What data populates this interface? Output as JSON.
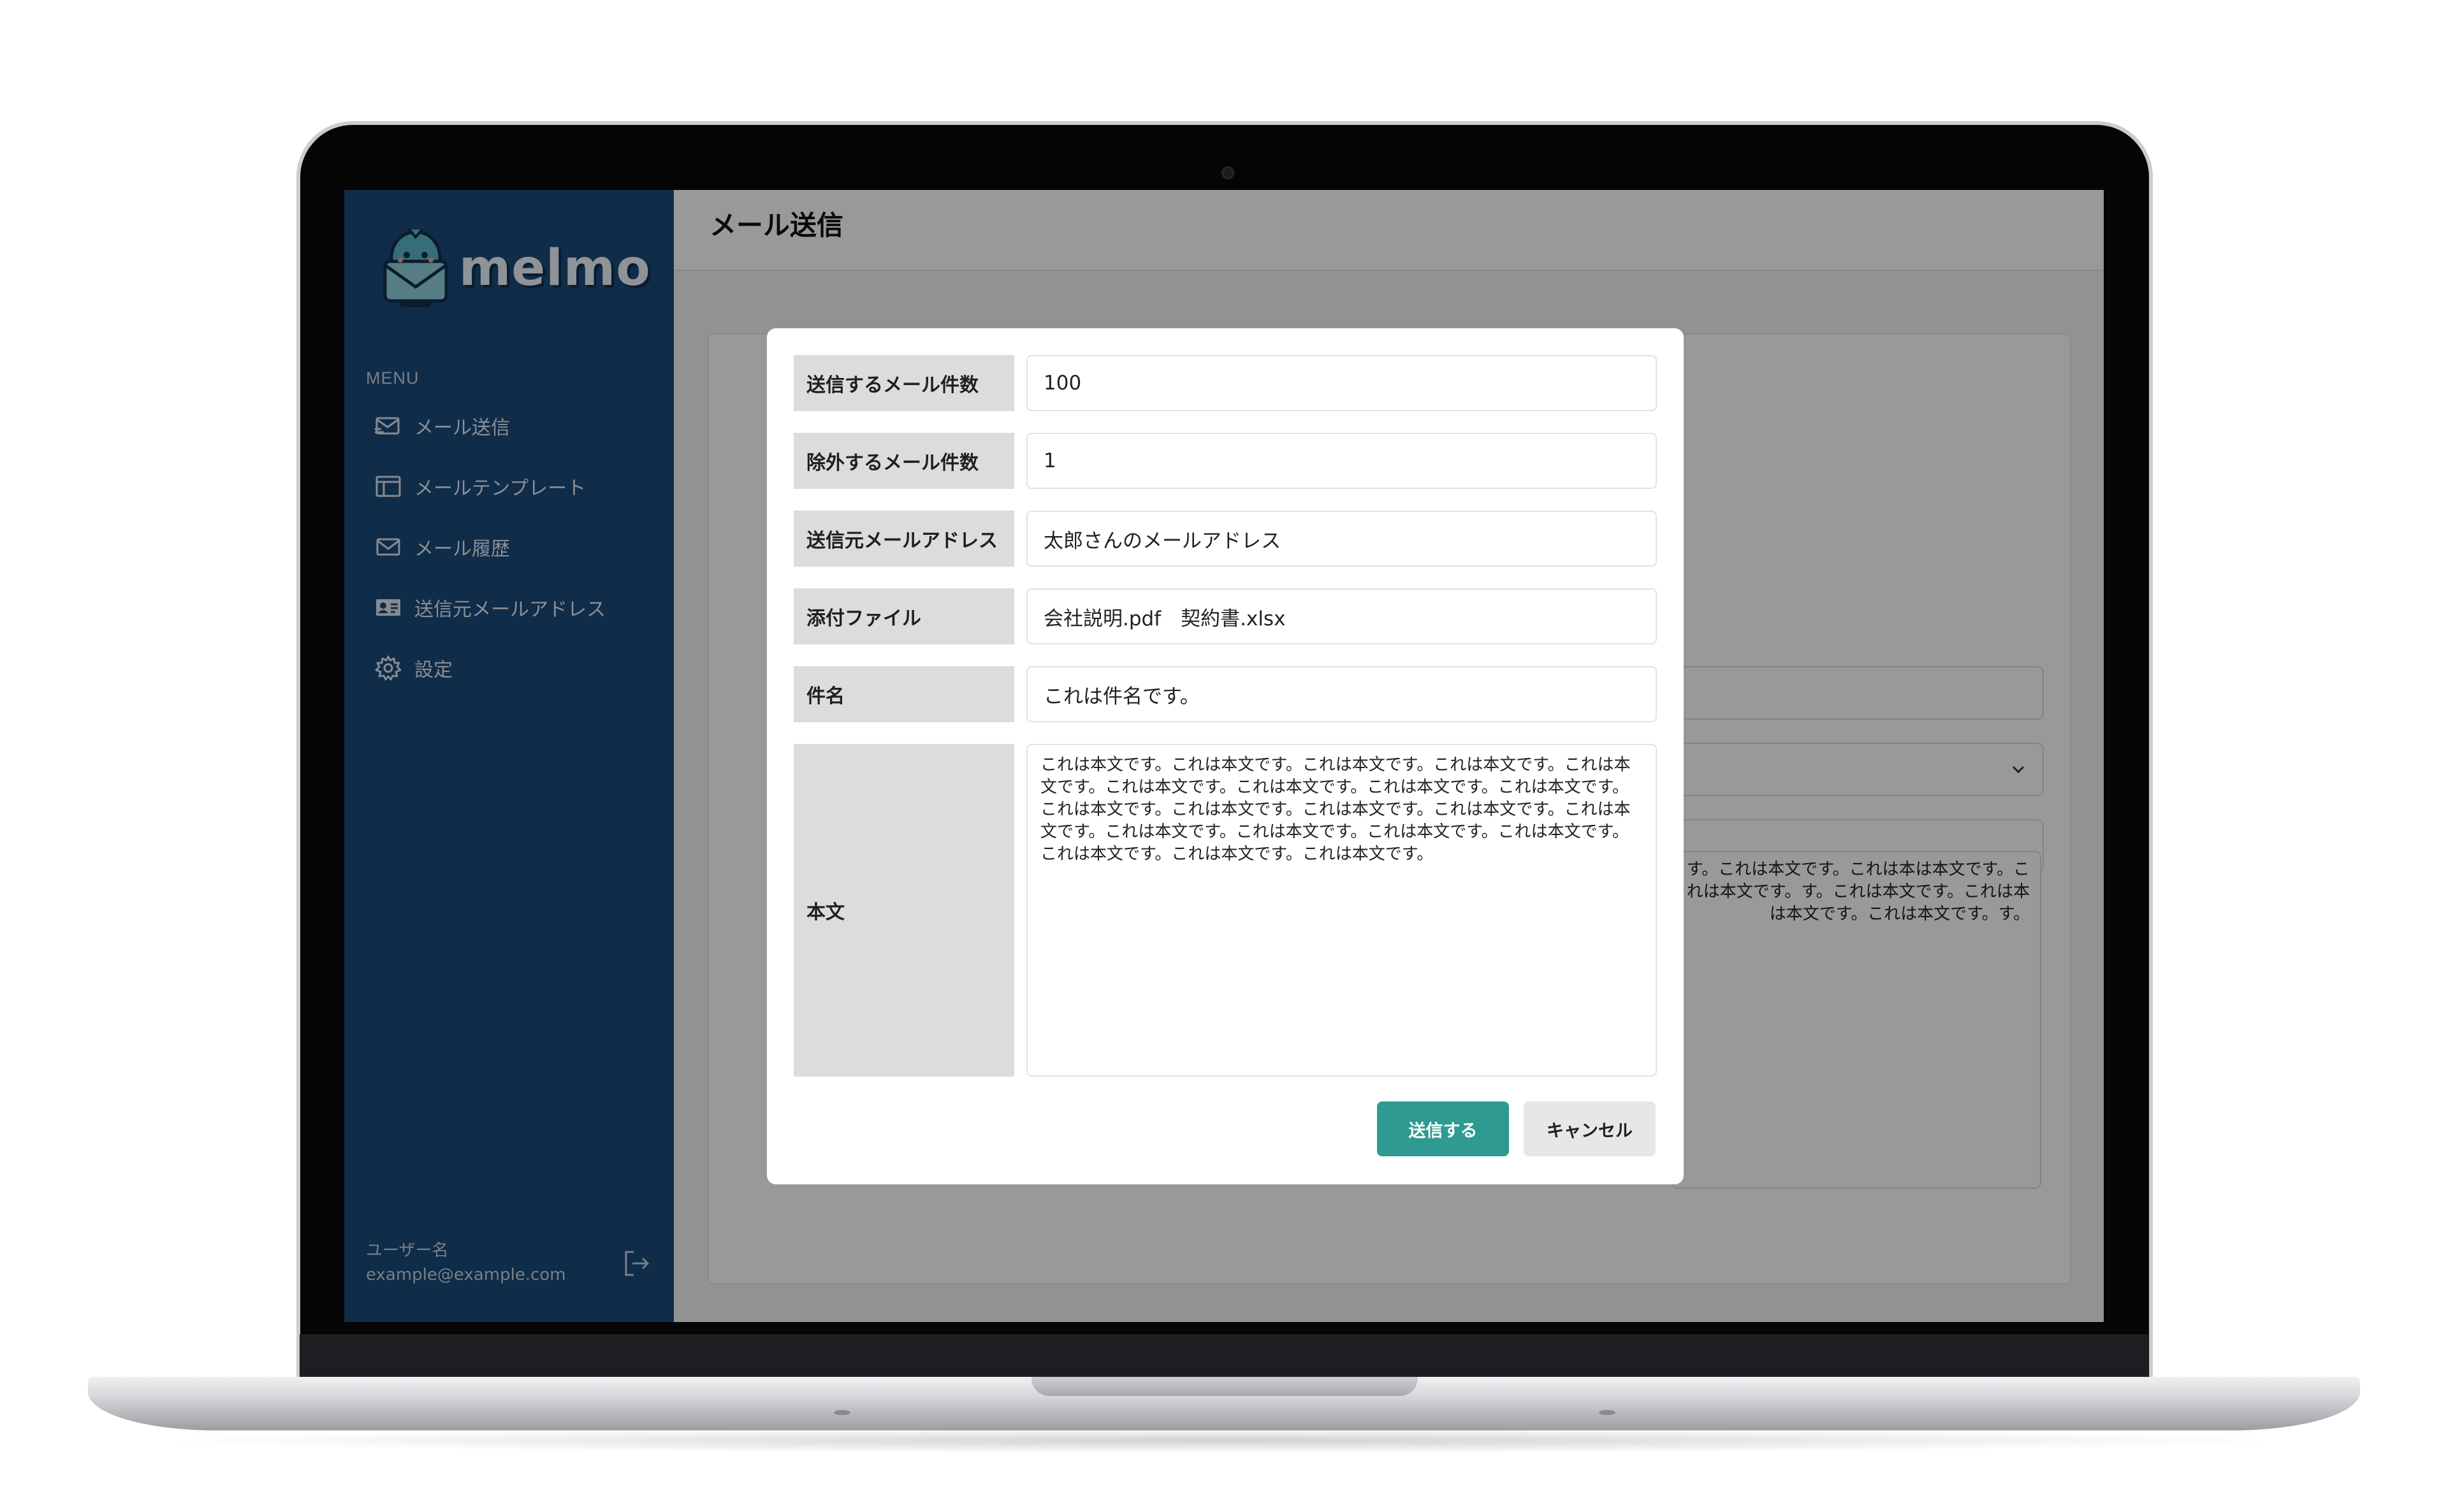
{
  "sidebar": {
    "logo_text": "melmo",
    "menu_label": "MENU",
    "items": [
      {
        "label": "メール送信",
        "icon": "send-mail-icon"
      },
      {
        "label": "メールテンプレート",
        "icon": "template-icon"
      },
      {
        "label": "メール履歴",
        "icon": "mail-history-icon"
      },
      {
        "label": "送信元メールアドレス",
        "icon": "id-card-icon"
      },
      {
        "label": "設定",
        "icon": "gear-icon"
      }
    ],
    "user": {
      "name": "ユーザー名",
      "email": "example@example.com"
    }
  },
  "header": {
    "title": "メール送信"
  },
  "background_form": {
    "body_preview": "す。これは本文です。これは本は本文です。これは本文です。す。これは本文です。これは本は本文です。これは本文です。す。"
  },
  "modal": {
    "fields": [
      {
        "label": "送信するメール件数",
        "value": "100"
      },
      {
        "label": "除外するメール件数",
        "value": "1"
      },
      {
        "label": "送信元メールアドレス",
        "value": "太郎さんのメールアドレス"
      },
      {
        "label": "添付ファイル",
        "value": "会社説明.pdf　契約書.xlsx"
      },
      {
        "label": "件名",
        "value": "これは件名です。"
      },
      {
        "label": "本文",
        "value": "これは本文です。これは本文です。これは本文です。これは本文です。これは本文です。これは本文です。これは本文です。これは本文です。これは本文です。これは本文です。これは本文です。これは本文です。これは本文です。これは本文です。これは本文です。これは本文です。これは本文です。これは本文です。これは本文です。これは本文です。これは本文です。"
      }
    ],
    "send_label": "送信する",
    "cancel_label": "キャンセル"
  },
  "colors": {
    "sidebar": "#1a4a7a",
    "primary_button": "#2f9a8f",
    "label_background": "#dcdcdc"
  }
}
